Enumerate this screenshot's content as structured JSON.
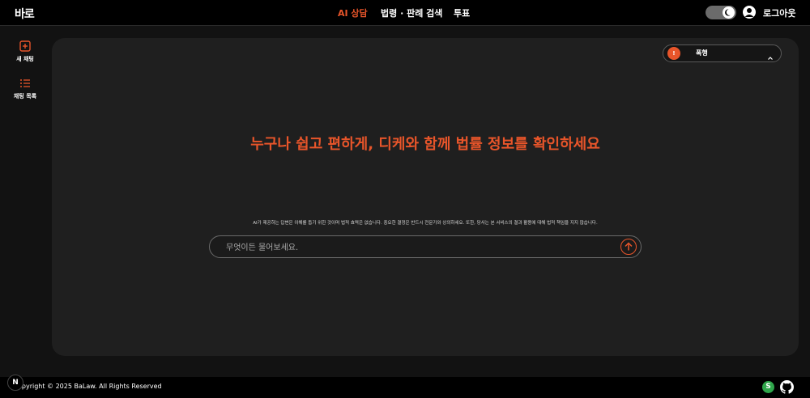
{
  "header": {
    "logo": "바로",
    "nav": [
      {
        "label": "AI 상담",
        "active": true
      },
      {
        "label": "법령 · 판례 검색",
        "active": false
      },
      {
        "label": "투표",
        "active": false
      }
    ],
    "theme_toggle_icon": "moon-icon",
    "user_icon": "user-icon",
    "logout_label": "로그아웃"
  },
  "sidebar": {
    "items": [
      {
        "label": "새 채팅",
        "icon": "plus-square-icon"
      },
      {
        "label": "채팅 목록",
        "icon": "list-icon"
      }
    ]
  },
  "main": {
    "category": {
      "badge": "!",
      "label": "폭행"
    },
    "headline": "누구나 쉽고 편하게, 디케와 함께 법률 정보를 확인하세요",
    "disclaimer": "AI가 제공하는 답변은 이해를 돕기 위한 것이며 법적 효력은 없습니다. 중요한 결정은 반드시 전문가와 상의하세요. 또한, 당사는 본 서비스의 결과 활용에 대해 법적 책임을 지지 않습니다.",
    "search_placeholder": "무엇이든 물어보세요."
  },
  "footer": {
    "copyright": "opyright © 2025 BaLaw. All Rights Reserved",
    "n_badge": "N",
    "s_badge": "S"
  },
  "colors": {
    "accent": "#e8552a",
    "background": "#121212",
    "panel": "#1f1f1f",
    "topbar": "#000000"
  }
}
